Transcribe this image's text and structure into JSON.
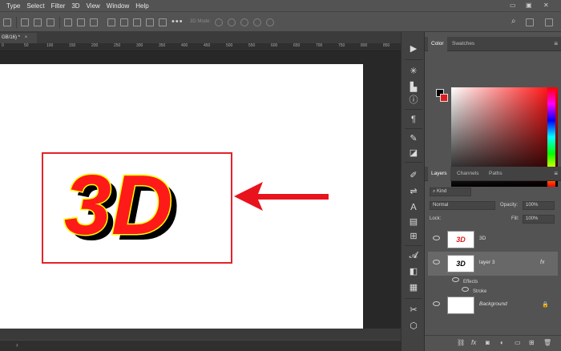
{
  "menu": {
    "items": [
      "Type",
      "Select",
      "Filter",
      "3D",
      "View",
      "Window",
      "Help"
    ]
  },
  "options_bar": {
    "mode_label": "3D Mode:"
  },
  "document": {
    "tab_label": "GB/16) *",
    "tab_close": "×",
    "ruler_ticks": [
      "0",
      "50",
      "100",
      "150",
      "200",
      "250",
      "300",
      "350",
      "400",
      "450",
      "500",
      "550",
      "600",
      "650",
      "700",
      "750",
      "800",
      "850"
    ]
  },
  "canvas_text": {
    "headline": "3D"
  },
  "colors": {
    "selection_box": "#e2232a",
    "text_fill": "#ff1a1a",
    "text_stroke": "#ffff00",
    "shadow": "#000000",
    "arrow": "#e8131c"
  },
  "color_panel": {
    "tabs": [
      "Color",
      "Swatches"
    ]
  },
  "layers_panel": {
    "tabs": [
      "Layers",
      "Channels",
      "Paths"
    ],
    "filter_kind": "Kind",
    "blend_mode": "Normal",
    "opacity_label": "Opacity:",
    "opacity_value": "100%",
    "lock_label": "Lock:",
    "fill_label": "Fill:",
    "fill_value": "100%",
    "layers": [
      {
        "name": "3D",
        "thumb_text": "3D"
      },
      {
        "name": "layer 3",
        "thumb_text": "3D",
        "fx": "fx"
      },
      {
        "name": "Background"
      }
    ],
    "effects_label": "Effects",
    "stroke_label": "Stroke",
    "footer_fx": "fx"
  },
  "status_bar": {
    "chevron": "›"
  }
}
